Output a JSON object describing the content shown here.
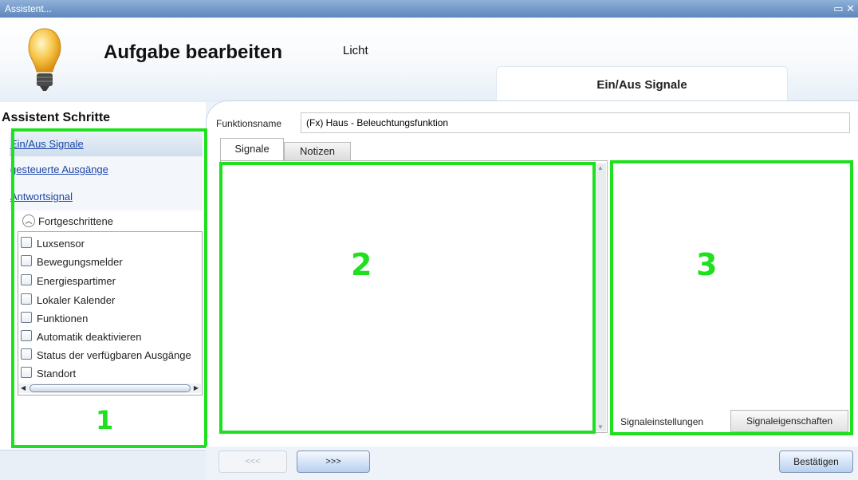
{
  "window": {
    "title": "Assistent..."
  },
  "header": {
    "title": "Aufgabe bearbeiten",
    "subtitle": "Licht",
    "active_step_tab": "Ein/Aus Signale"
  },
  "sidebar": {
    "title": "Assistent Schritte",
    "steps": [
      {
        "label": "Ein/Aus Signale",
        "active": true
      },
      {
        "label": "gesteuerte Ausgänge",
        "active": false
      },
      {
        "label": "Antwortsignal",
        "active": false
      }
    ],
    "advanced_label": "Fortgeschrittene",
    "advanced_items": [
      {
        "label": "Luxsensor",
        "checked": false
      },
      {
        "label": "Bewegungsmelder",
        "checked": false
      },
      {
        "label": "Energiespartimer",
        "checked": false
      },
      {
        "label": "Lokaler Kalender",
        "checked": false
      },
      {
        "label": "Funktionen",
        "checked": false
      },
      {
        "label": "Automatik deaktivieren",
        "checked": false
      },
      {
        "label": "Status der verfügbaren Ausgänge",
        "checked": false
      },
      {
        "label": "Standort",
        "checked": false
      }
    ]
  },
  "main": {
    "function_name_label": "Funktionsname",
    "function_name_value": "(Fx) Haus - Beleuchtungsfunktion",
    "tabs": [
      {
        "label": "Signale",
        "active": true
      },
      {
        "label": "Notizen",
        "active": false
      }
    ],
    "right_tabs": [
      {
        "label": "Signaleinstellungen",
        "active": true
      },
      {
        "label": "Signaleigenschaften",
        "active": false
      }
    ]
  },
  "annotations": {
    "box1": "1",
    "box2": "2",
    "box3": "3",
    "color": "#1ee01e"
  },
  "footer": {
    "back_label": "<<<",
    "next_label": ">>>",
    "confirm_label": "Bestätigen"
  },
  "icons": {
    "window": "window-restore-icon",
    "bulb": "light-bulb-icon"
  }
}
